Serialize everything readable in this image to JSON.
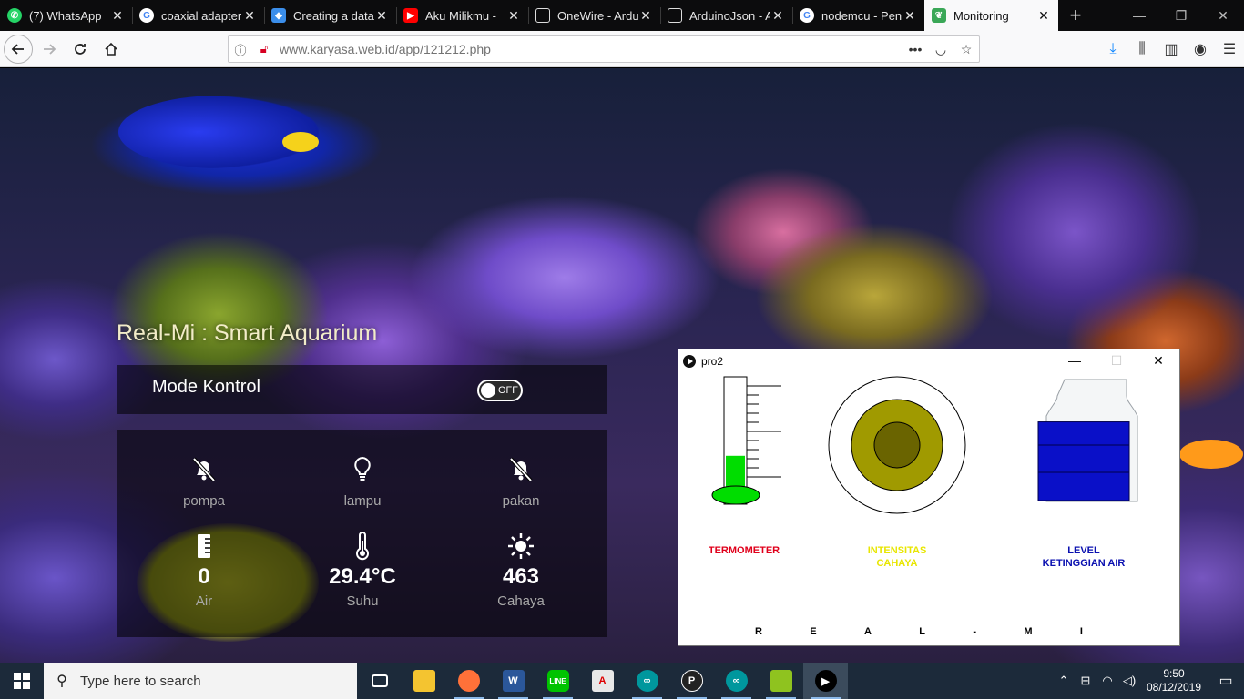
{
  "browser": {
    "tabs": [
      {
        "title": "(7) WhatsApp",
        "favicon": "whatsapp-icon",
        "color": "#25d366"
      },
      {
        "title": "coaxial adapter",
        "favicon": "google-icon",
        "color": "#ffffff"
      },
      {
        "title": "Creating a datab",
        "favicon": "shield-icon",
        "color": "#3b8eea"
      },
      {
        "title": "Aku Milikmu - ",
        "favicon": "youtube-icon",
        "color": "#ff0000"
      },
      {
        "title": "OneWire - Ardu",
        "favicon": "page-icon",
        "color": "#ffffff"
      },
      {
        "title": "ArduinoJson - A",
        "favicon": "page-icon",
        "color": "#ffffff"
      },
      {
        "title": "nodemcu - Pen",
        "favicon": "google-icon",
        "color": "#ffffff"
      },
      {
        "title": "Monitoring",
        "favicon": "leaf-icon",
        "color": "#3aa757",
        "active": true
      }
    ],
    "url_host": "www.karyasa.web.id",
    "url_path": "/app/121212.php"
  },
  "app": {
    "title": "Real-Mi : Smart Aquarium",
    "mode_label": "Mode Kontrol",
    "toggle_text": "OFF",
    "controls": [
      {
        "label": "pompa",
        "icon": "muted-bell-icon"
      },
      {
        "label": "lampu",
        "icon": "lightbulb-icon"
      },
      {
        "label": "pakan",
        "icon": "muted-bell-icon"
      }
    ],
    "sensors": [
      {
        "value": "0",
        "label": "Air",
        "icon": "water-level-icon"
      },
      {
        "value": "29.4°C",
        "label": "Suhu",
        "icon": "thermometer-icon"
      },
      {
        "value": "463",
        "label": "Cahaya",
        "icon": "sun-icon"
      }
    ]
  },
  "processing": {
    "window_title": "pro2",
    "labels": {
      "termometer": "TERMOMETER",
      "intensitas_line1": "INTENSITAS",
      "intensitas_line2": "CAHAYA",
      "level_line1": "LEVEL",
      "level_line2": "KETINGGIAN AIR"
    },
    "label_colors": {
      "termometer": "#e0001b",
      "intensitas": "#e8e600",
      "level": "#0a10b0"
    },
    "footer_letters": [
      "R",
      "E",
      "A",
      "L",
      "-",
      "M",
      "I"
    ],
    "thermometer_fill_fraction": 0.38,
    "water_level_fraction": 0.65
  },
  "taskbar": {
    "search_placeholder": "Type here to search",
    "time": "9:50",
    "date": "08/12/2019"
  }
}
